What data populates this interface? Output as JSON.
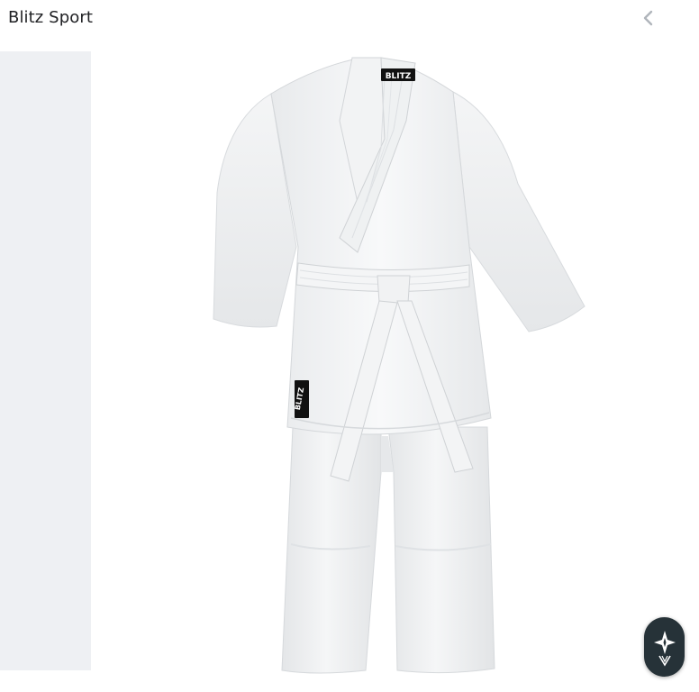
{
  "header": {
    "title": "Blitz Sport",
    "back_icon": "chevron-left-icon"
  },
  "product": {
    "image_icon": "karate-gi-image",
    "chest_badge_text": "BLITZ",
    "hip_badge_text": "BLITZ",
    "garment_color": "#f6f7f8"
  },
  "assistant_button": {
    "icon": "sparkle-assistant-icon"
  },
  "colors": {
    "left_panel": "#eef0f3",
    "fab": "#263238",
    "chevron": "#b0b5bb"
  }
}
